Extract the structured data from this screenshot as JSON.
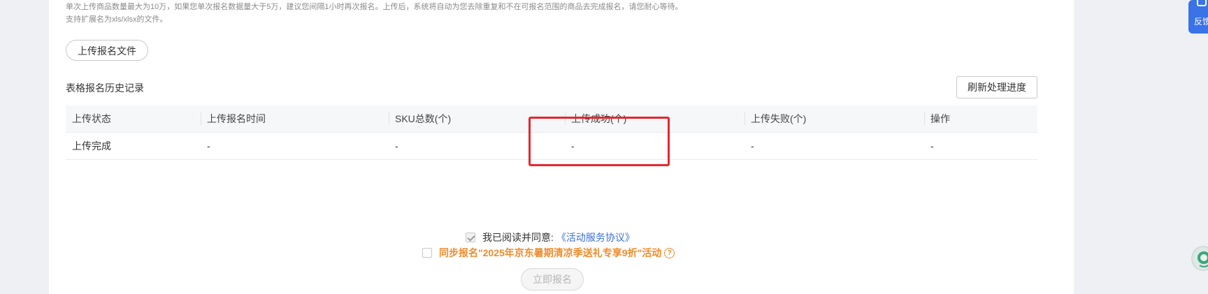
{
  "notice": {
    "line1": "单次上传商品数量最大为10万，如果您单次报名数据量大于5万，建议您间隔1小时再次报名。上传后，系统将自动为您去除重复和不在可报名范围的商品去完成报名，请您耐心等待。",
    "line2": "支持扩展名为xls/xlsx的文件。"
  },
  "upload_button": "上传报名文件",
  "history": {
    "title": "表格报名历史记录",
    "refresh_button": "刷新处理进度",
    "columns": [
      "上传状态",
      "上传报名时间",
      "SKU总数(个)",
      "上传成功(个)",
      "上传失败(个)",
      "操作"
    ],
    "rows": [
      [
        "上传完成",
        "-",
        "-",
        "-",
        "-",
        "-"
      ]
    ]
  },
  "agreement": {
    "checked": true,
    "text": "我已阅读并同意:",
    "link": "《活动服务协议》"
  },
  "sync": {
    "checked": false,
    "text": "同步报名\"2025年京东暑期清凉季送礼专享9折\"活动",
    "help_icon": "question-circle-icon"
  },
  "submit_button": "立即报名",
  "feedback": {
    "label": "反馈",
    "icon": "feedback-icon",
    "color": "#3a72e8"
  },
  "colors": {
    "highlight": "#e8262c",
    "link": "#3a6fe0",
    "sync_text": "#f08b2c"
  }
}
